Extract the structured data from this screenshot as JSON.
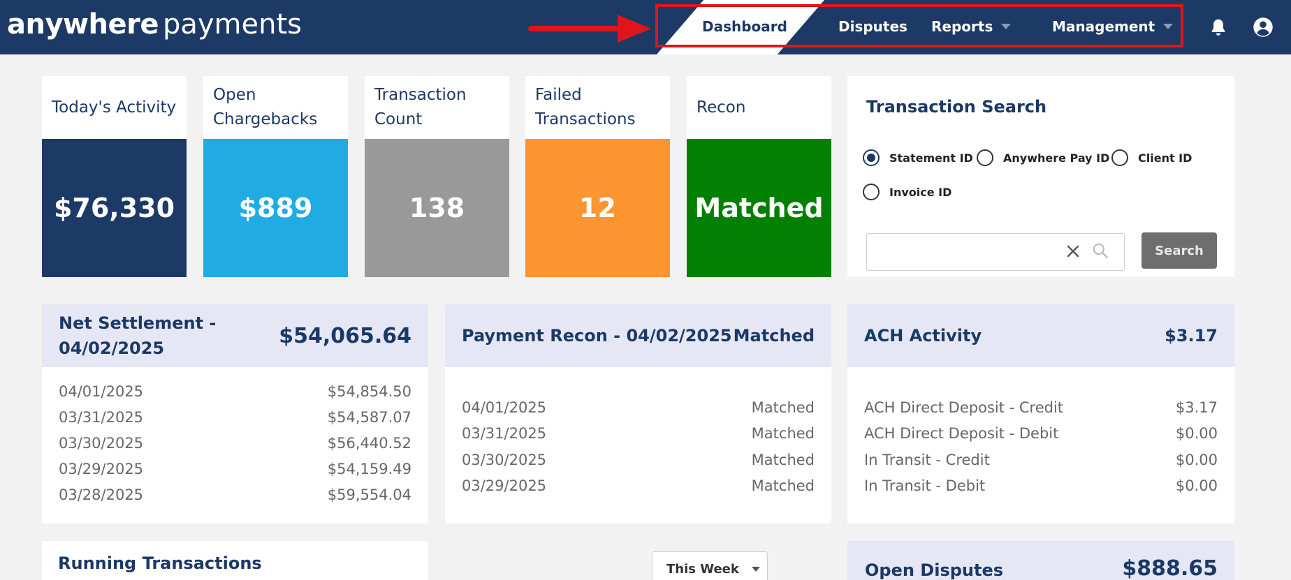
{
  "header": {
    "logo_bold": "anywhere",
    "logo_light": "payments",
    "nav": {
      "dashboard": "Dashboard",
      "disputes": "Disputes",
      "reports": "Reports",
      "management": "Management"
    },
    "icons": [
      "bell-icon",
      "user-icon"
    ]
  },
  "colors": {
    "header_bg": "#1d3966",
    "highlight": "#e0141b",
    "todays_activity": "#1d3966",
    "open_chargebacks": "#20ace3",
    "transaction_count": "#999999",
    "failed_transactions": "#fd9530",
    "recon": "#018001"
  },
  "tiles": [
    {
      "title": "Today's Activity",
      "value": "$76,330"
    },
    {
      "title": "Open Chargebacks",
      "value": "$889"
    },
    {
      "title": "Transaction Count",
      "value": "138"
    },
    {
      "title": "Failed Transactions",
      "value": "12"
    },
    {
      "title": "Recon",
      "value": "Matched"
    }
  ],
  "search": {
    "title": "Transaction Search",
    "options": [
      "Statement ID",
      "Anywhere Pay ID",
      "Client ID",
      "Invoice ID"
    ],
    "selected": "Statement ID",
    "input_value": "",
    "button": "Search"
  },
  "net_settlement": {
    "title": "Net Settlement - 04/02/2025",
    "value": "$54,065.64",
    "rows": [
      {
        "date": "04/01/2025",
        "amount": "$54,854.50"
      },
      {
        "date": "03/31/2025",
        "amount": "$54,587.07"
      },
      {
        "date": "03/30/2025",
        "amount": "$56,440.52"
      },
      {
        "date": "03/29/2025",
        "amount": "$54,159.49"
      },
      {
        "date": "03/28/2025",
        "amount": "$59,554.04"
      }
    ]
  },
  "payment_recon": {
    "title": "Payment Recon - 04/02/2025",
    "value": "Matched",
    "rows": [
      {
        "date": "04/01/2025",
        "status": "Matched"
      },
      {
        "date": "03/31/2025",
        "status": "Matched"
      },
      {
        "date": "03/30/2025",
        "status": "Matched"
      },
      {
        "date": "03/29/2025",
        "status": "Matched"
      }
    ]
  },
  "ach": {
    "title": "ACH Activity",
    "value": "$3.17",
    "rows": [
      {
        "label": "ACH Direct Deposit - Credit",
        "amount": "$3.17"
      },
      {
        "label": "ACH Direct Deposit - Debit",
        "amount": "$0.00"
      },
      {
        "label": "In Transit - Credit",
        "amount": "$0.00"
      },
      {
        "label": "In Transit - Debit",
        "amount": "$0.00"
      }
    ]
  },
  "running": {
    "title": "Running Transactions",
    "period": "This Week"
  },
  "open_disputes": {
    "title": "Open Disputes",
    "value": "$888.65"
  }
}
